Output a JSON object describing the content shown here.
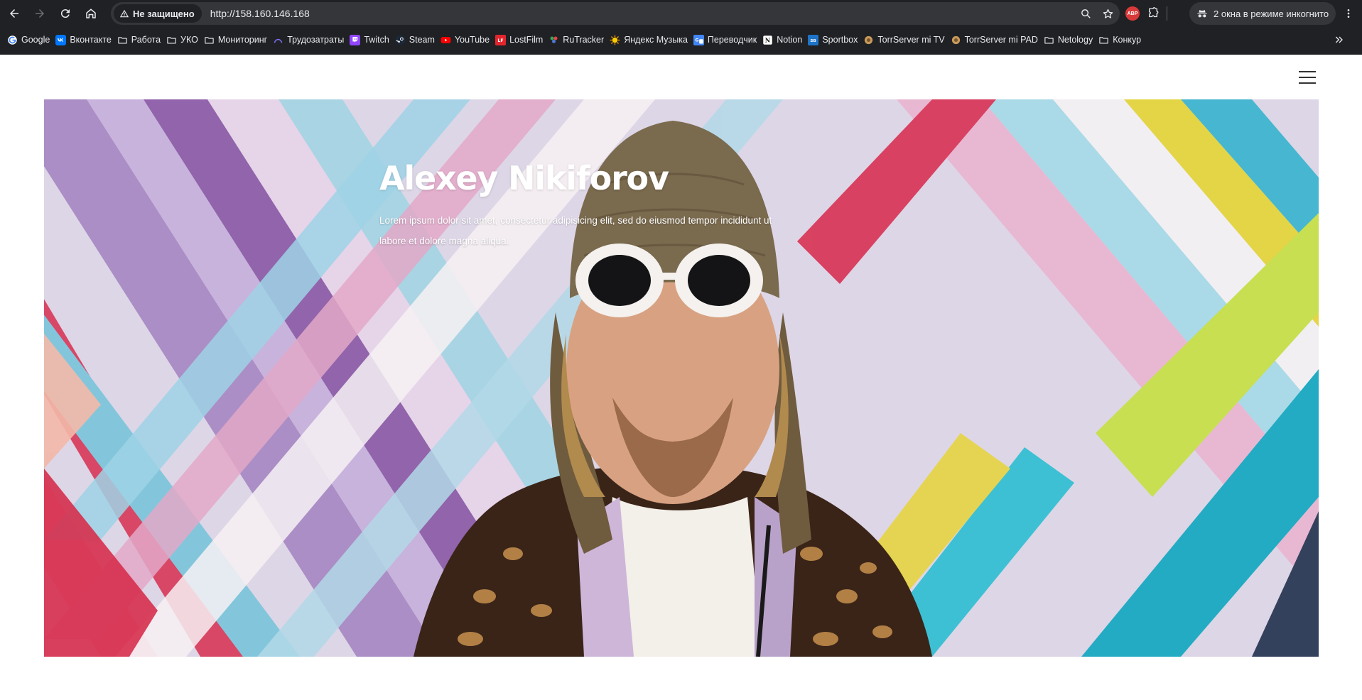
{
  "browser": {
    "security_label": "Не защищено",
    "url": "http://158.160.146.168",
    "incognito_label": "2 окна в режиме инкогнито",
    "abp_label": "ABP"
  },
  "bookmarks": [
    {
      "label": "Google",
      "icon": "google-icon"
    },
    {
      "label": "Вконтакте",
      "icon": "vk-icon"
    },
    {
      "label": "Работа",
      "icon": "folder-icon"
    },
    {
      "label": "УКО",
      "icon": "folder-icon"
    },
    {
      "label": "Мониторинг",
      "icon": "folder-icon"
    },
    {
      "label": "Трудозатраты",
      "icon": "trudozatraty-icon"
    },
    {
      "label": "Twitch",
      "icon": "twitch-icon"
    },
    {
      "label": "Steam",
      "icon": "steam-icon"
    },
    {
      "label": "YouTube",
      "icon": "youtube-icon"
    },
    {
      "label": "LostFilm",
      "icon": "lostfilm-icon"
    },
    {
      "label": "RuTracker",
      "icon": "rutracker-icon"
    },
    {
      "label": "Яндекс Музыка",
      "icon": "yandex-music-icon"
    },
    {
      "label": "Переводчик",
      "icon": "translate-icon"
    },
    {
      "label": "Notion",
      "icon": "notion-icon"
    },
    {
      "label": "Sportbox",
      "icon": "sportbox-icon"
    },
    {
      "label": "TorrServer mi TV",
      "icon": "torrserver-icon"
    },
    {
      "label": "TorrServer mi PAD",
      "icon": "torrserver-icon"
    },
    {
      "label": "Netology",
      "icon": "folder-icon"
    },
    {
      "label": "Конкур",
      "icon": "folder-icon"
    }
  ],
  "hero": {
    "title": "Alexey Nikiforov",
    "text": "Lorem ipsum dolor sit amet, consectetur adipisicing elit, sed do eiusmod tempor incididunt ut labore et dolore magna aliqua."
  },
  "colors": {
    "chrome_bg": "#202124",
    "omnibox_bg": "#35363a",
    "chrome_text": "#e8eaed",
    "hero_text": "#ffffff",
    "page_bg": "#ffffff"
  }
}
